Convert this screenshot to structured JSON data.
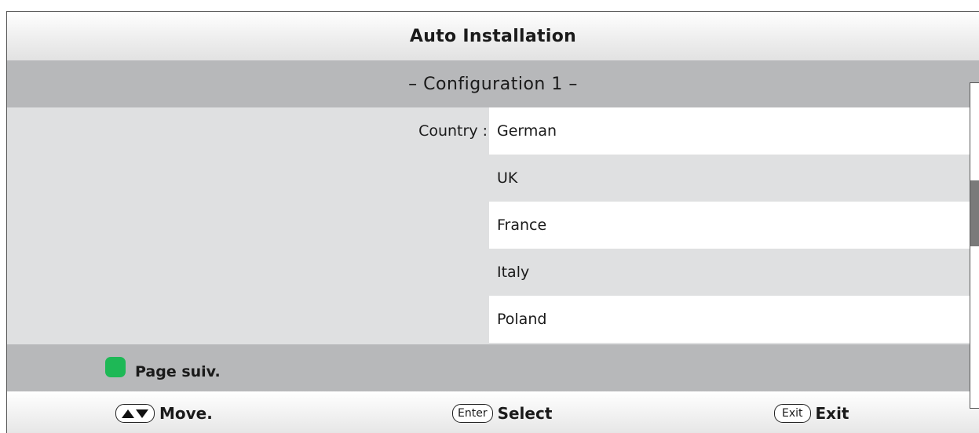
{
  "header": {
    "title": "Auto Installation"
  },
  "subheader": {
    "title": "– Configuration 1 –"
  },
  "country": {
    "label": "Country :",
    "options": [
      "German",
      "UK",
      "France",
      "Italy",
      "Poland"
    ]
  },
  "color_bar": {
    "green_label": "Page suiv."
  },
  "footer": {
    "move": {
      "key_icon": "up-down-arrows-icon",
      "label": "Move."
    },
    "select": {
      "key": "Enter",
      "label": "Select"
    },
    "exit": {
      "key": "Exit",
      "label": "Exit"
    }
  },
  "colors": {
    "green_key": "#1eb856",
    "panel_gray": "#dfe0e1",
    "bar_gray": "#b7b8ba"
  }
}
